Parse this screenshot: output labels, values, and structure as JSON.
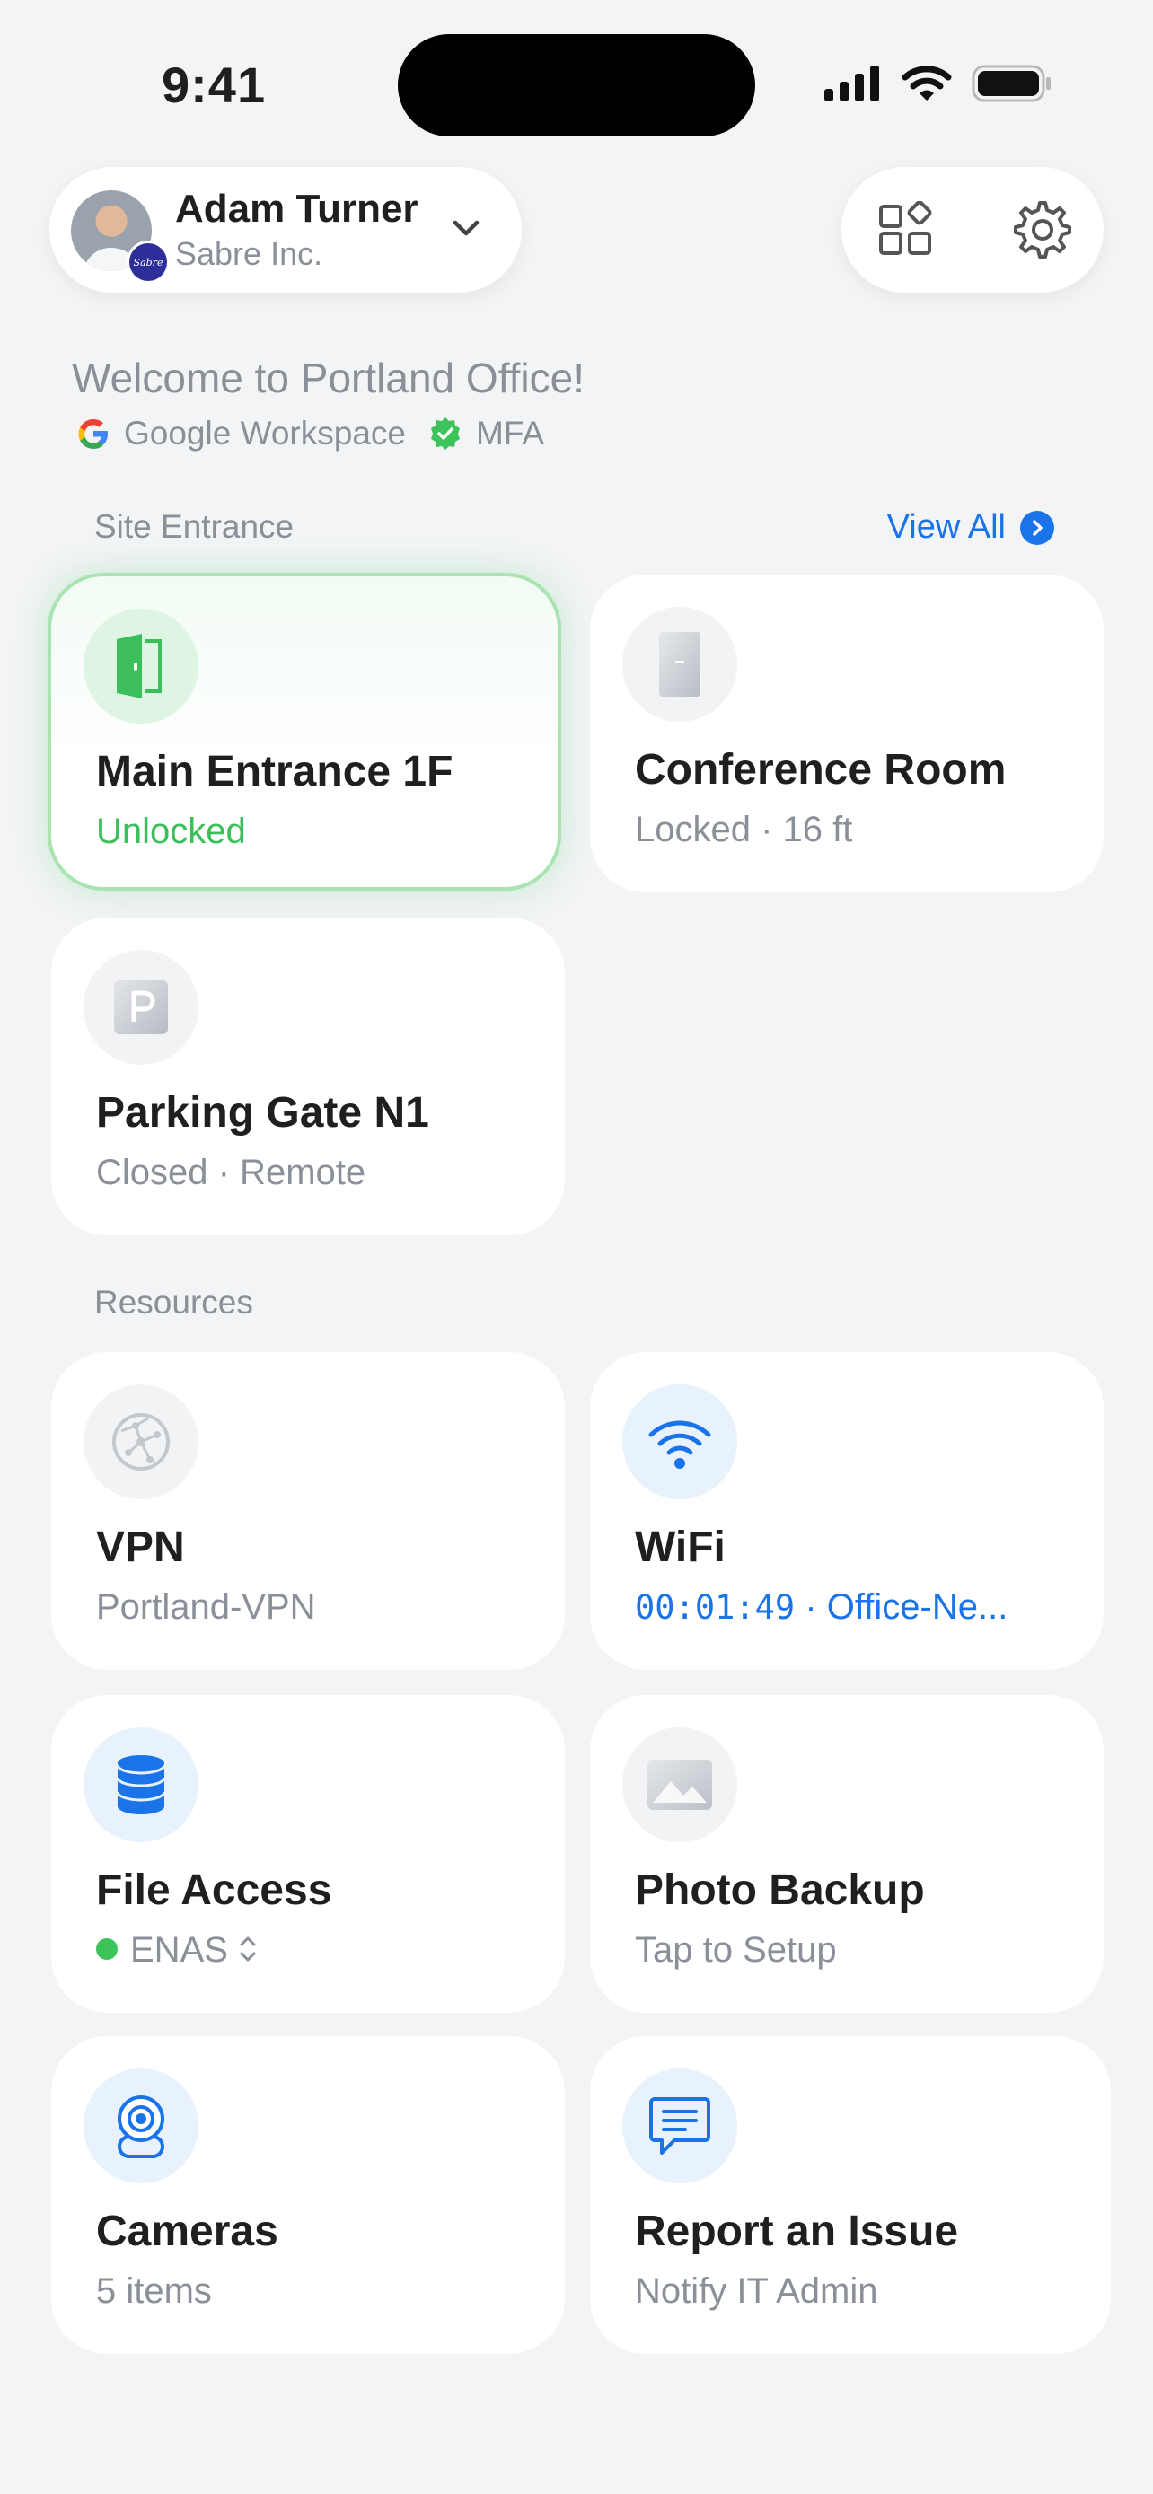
{
  "status_bar": {
    "time": "9:41"
  },
  "account": {
    "name": "Adam Turner",
    "org": "Sabre Inc.",
    "org_badge": "Sabre"
  },
  "header_icons": [
    "apps-grid-icon",
    "gear-icon"
  ],
  "welcome": {
    "title": "Welcome to Portland Office!",
    "provider": "Google Workspace",
    "mfa": "MFA"
  },
  "site_entrance": {
    "label": "Site Entrance",
    "view_all": "View All",
    "items": [
      {
        "title": "Main Entrance 1F",
        "subtitle": "Unlocked",
        "icon": "door-open-icon",
        "state": "active"
      },
      {
        "title": "Conference Room",
        "subtitle": "Locked · 16 ft",
        "icon": "door-closed-icon",
        "state": "idle"
      },
      {
        "title": "Parking Gate N1",
        "subtitle": "Closed · Remote",
        "icon": "parking-icon",
        "state": "idle"
      }
    ]
  },
  "resources": {
    "label": "Resources",
    "items": [
      {
        "title": "VPN",
        "subtitle": "Portland-VPN",
        "icon": "globe-network-icon"
      },
      {
        "title": "WiFi",
        "subtitle": "00:01:49 · Office-Ne...",
        "subtitle_timer": "00:01:49",
        "subtitle_rest": " · Office-Ne...",
        "icon": "wifi-icon"
      },
      {
        "title": "File Access",
        "subtitle": "ENAS",
        "icon": "database-icon"
      },
      {
        "title": "Photo Backup",
        "subtitle": "Tap to Setup",
        "icon": "photo-icon"
      },
      {
        "title": "Cameras",
        "subtitle": "5 items",
        "icon": "camera-icon"
      },
      {
        "title": "Report an Issue",
        "subtitle": "Notify IT Admin",
        "icon": "chat-report-icon"
      }
    ]
  },
  "colors": {
    "accent_blue": "#1a73e8",
    "success_green": "#3cbe5a",
    "background": "#f3f4f6"
  }
}
